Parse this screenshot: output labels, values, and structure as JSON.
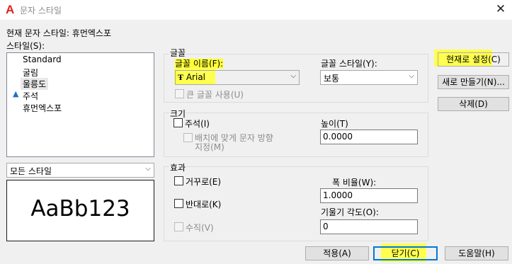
{
  "window": {
    "app_icon_text": "A",
    "title": "문자 스타일",
    "close_glyph": "✕"
  },
  "current_style": {
    "label": "현재 문자 스타일:",
    "value": "휴먼엑스포"
  },
  "styles_list": {
    "label": "스타일(S):",
    "items": [
      "Standard",
      "굴림",
      "울릉도",
      "주석",
      "휴먼엑스포"
    ],
    "selected": "울릉도",
    "annotative_item": "주석"
  },
  "filter": {
    "value": "모든 스타일"
  },
  "preview": {
    "text": "AaBb123"
  },
  "font_group": {
    "title": "글꼴",
    "name_label": "글꼴 이름(F):",
    "name_value": "Arial",
    "name_icon": "truetype-font-icon",
    "style_label": "글꼴 스타일(Y):",
    "style_value": "보통",
    "bigfont_label": "큰 글꼴 사용(U)"
  },
  "size_group": {
    "title": "크기",
    "annotative_label": "주석(I)",
    "match_orientation_line1": "배치에 맞게 문자 방향",
    "match_orientation_line2": "지정(M)",
    "height_label": "높이(T)",
    "height_value": "0.0000"
  },
  "effects_group": {
    "title": "효과",
    "upside_down_label": "거꾸로(E)",
    "backwards_label": "반대로(K)",
    "vertical_label": "수직(V)",
    "width_factor_label": "폭 비율(W):",
    "width_factor_value": "1.0000",
    "oblique_label": "기울기 각도(O):",
    "oblique_value": "0"
  },
  "side_buttons": {
    "set_current": "현재로 설정(C)",
    "new": "새로 만들기(N)...",
    "delete": "삭제(D)"
  },
  "bottom_buttons": {
    "apply": "적용(A)",
    "close": "닫기(C)",
    "help": "도움말(H)"
  },
  "colors": {
    "highlight": "#ffff33",
    "accent": "#0078d7",
    "app_icon": "#e0201b"
  }
}
